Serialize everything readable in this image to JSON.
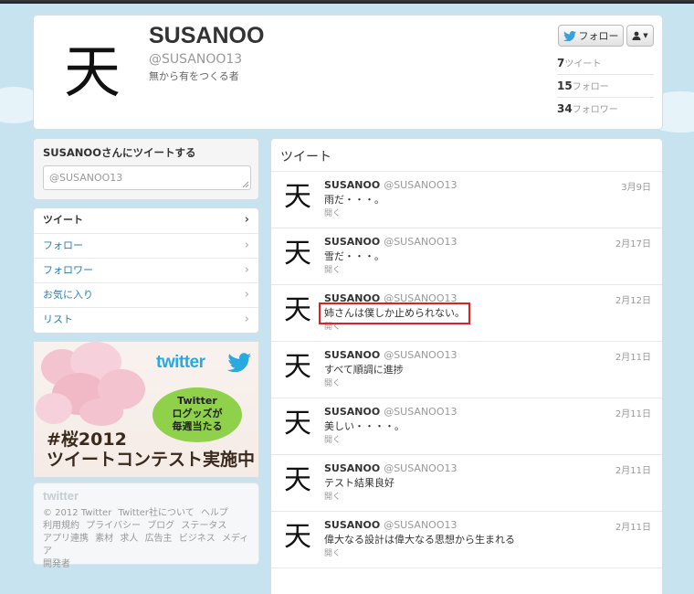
{
  "profile": {
    "avatar_char": "天",
    "name": "SUSANOO",
    "handle": "@SUSANOO13",
    "bio": "無から有をつくる者",
    "follow_label": "フォロー",
    "stats": [
      {
        "value": "7",
        "label": "ツイート"
      },
      {
        "value": "15",
        "label": "フォロー"
      },
      {
        "value": "34",
        "label": "フォロワー"
      }
    ]
  },
  "compose": {
    "title": "SUSANOOさんにツイートする",
    "placeholder": "@SUSANOO13"
  },
  "nav": {
    "items": [
      {
        "label": "ツイート"
      },
      {
        "label": "フォロー"
      },
      {
        "label": "フォロワー"
      },
      {
        "label": "お気に入り"
      },
      {
        "label": "リスト"
      }
    ]
  },
  "ad": {
    "logo": "twitter",
    "bubble_line1": "Twitter",
    "bubble_line2": "ログッズが",
    "bubble_line3": "毎週当たる",
    "title_line1": "#桜2012",
    "title_line2": "ツイートコンテスト実施中"
  },
  "footer": {
    "logo": "twitter",
    "links": [
      "© 2012 Twitter",
      "Twitter社について",
      "ヘルプ",
      "利用規約",
      "プライバシー",
      "ブログ",
      "ステータス",
      "アプリ連携",
      "素材",
      "求人",
      "広告主",
      "ビジネス",
      "メディア",
      "開発者"
    ]
  },
  "timeline": {
    "title": "ツイート",
    "tweets": [
      {
        "name": "SUSANOO",
        "handle": "@SUSANOO13",
        "date": "3月9日",
        "text": "雨だ・・・。",
        "action": "開く"
      },
      {
        "name": "SUSANOO",
        "handle": "@SUSANOO13",
        "date": "2月17日",
        "text": "雪だ・・・。",
        "action": "開く"
      },
      {
        "name": "SUSANOO",
        "handle": "@SUSANOO13",
        "date": "2月12日",
        "text": "姉さんは僕しか止められない。",
        "action": "開く"
      },
      {
        "name": "SUSANOO",
        "handle": "@SUSANOO13",
        "date": "2月11日",
        "text": "すべて順調に進捗",
        "action": "開く"
      },
      {
        "name": "SUSANOO",
        "handle": "@SUSANOO13",
        "date": "2月11日",
        "text": "美しい・・・・。",
        "action": "開く"
      },
      {
        "name": "SUSANOO",
        "handle": "@SUSANOO13",
        "date": "2月11日",
        "text": "テスト結果良好",
        "action": "開く"
      },
      {
        "name": "SUSANOO",
        "handle": "@SUSANOO13",
        "date": "2月11日",
        "text": "偉大なる設計は偉大なる思想から生まれる",
        "action": "開く"
      }
    ]
  }
}
